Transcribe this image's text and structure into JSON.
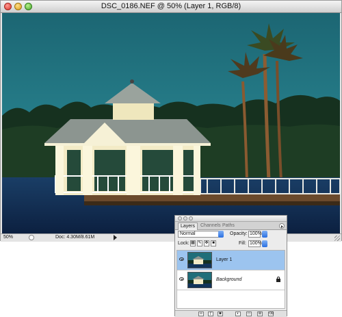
{
  "document": {
    "title": "DSC_0186.NEF @ 50% (Layer 1, RGB/8)",
    "zoom": "50%",
    "doc_size": "Doc: 4.30M/8.61M"
  },
  "layers_panel": {
    "tabs": [
      "Layers",
      "Channels",
      "Paths"
    ],
    "blend_mode": "Normal",
    "opacity_label": "Opacity:",
    "opacity_value": "100%",
    "lock_label": "Lock:",
    "fill_label": "Fill:",
    "fill_value": "100%",
    "layers": [
      {
        "name": "Layer 1",
        "selected": true,
        "visible": true,
        "locked": false
      },
      {
        "name": "Background",
        "selected": false,
        "visible": true,
        "locked": true
      }
    ]
  },
  "colors": {
    "selection": "#9cc4ef",
    "sky": "#1f6e7a",
    "water": "#12345a"
  },
  "icons": {
    "panel_footer": [
      "link-icon",
      "layer-style-icon",
      "layer-mask-icon",
      "adjustment-layer-icon",
      "new-group-icon",
      "new-layer-icon",
      "trash-icon"
    ]
  }
}
